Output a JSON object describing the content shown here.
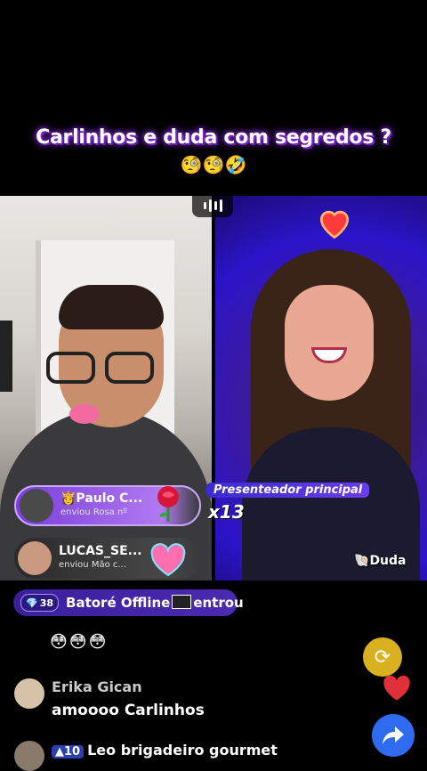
{
  "caption": {
    "title": "Carlinhos e duda com segredos ?",
    "emojis": "🧐🧐🤣"
  },
  "stream": {
    "host_right_name": "Duda",
    "host_right_icon": "seashell-icon"
  },
  "gifts": [
    {
      "name": "👸Paulo C...",
      "action": "enviou Rosa nº",
      "gift_icon": "rose-icon"
    },
    {
      "name": "LUCAS_SE...",
      "action": "enviou Mão c...",
      "gift_icon": "heart-hands-icon"
    }
  ],
  "top_gifter": {
    "label": "Presenteador principal",
    "multiplier": "x13"
  },
  "entered": {
    "level": "38",
    "text_before": "Batoré Offline",
    "text_after": "entrou"
  },
  "emoji_comment": "😳😳😳",
  "comments": [
    {
      "name": "Erika Gican",
      "message": "amoooo Carlinhos"
    },
    {
      "level": "10",
      "name": "Leo brigadeiro gourmet"
    }
  ],
  "colors": {
    "accent_purple": "#7a3fd9",
    "share_blue": "#2e6bf0",
    "like_red": "#e0303a",
    "gold": "#d8b020"
  }
}
